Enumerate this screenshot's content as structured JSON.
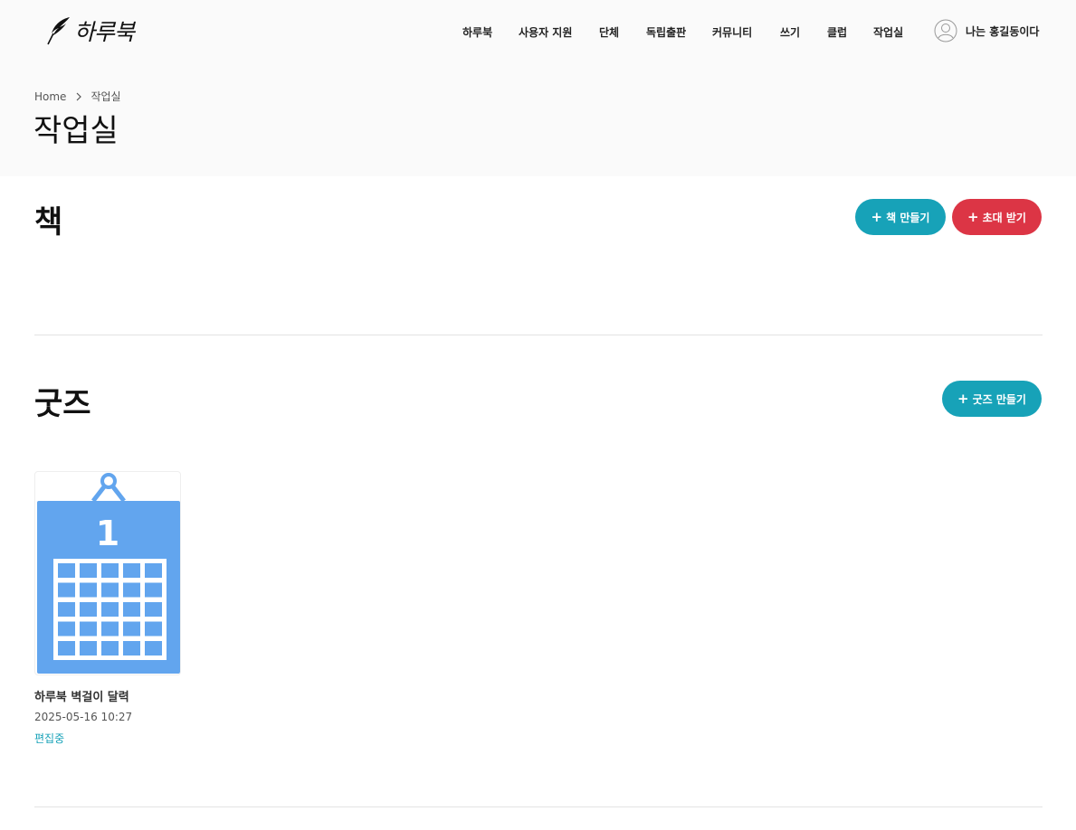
{
  "header": {
    "logo_text": "하루북",
    "nav": [
      "하루북",
      "사용자 지원",
      "단체",
      "독립출판",
      "커뮤니티",
      "쓰기",
      "클럽",
      "작업실"
    ],
    "user_name": "나는 홍길동이다"
  },
  "breadcrumb": {
    "home": "Home",
    "current": "작업실"
  },
  "page_title": "작업실",
  "books_section": {
    "title": "책",
    "create_button": "책 만들기",
    "invite_button": "초대 받기"
  },
  "goods_section": {
    "title": "굿즈",
    "create_button": "굿즈 만들기",
    "items": [
      {
        "title": "하루북 벽걸이 달력",
        "date": "2025-05-16 10:27",
        "status": "편집중",
        "calendar_number": "1"
      }
    ]
  },
  "colors": {
    "teal": "#17a2b8",
    "red": "#dc3545",
    "calendar_blue": "#62a5ee"
  },
  "icons": {
    "logo": "quill-icon",
    "user": "user-avatar-icon",
    "breadcrumb_separator": "chevron-right-icon",
    "button_prefix": "plus-icon"
  }
}
